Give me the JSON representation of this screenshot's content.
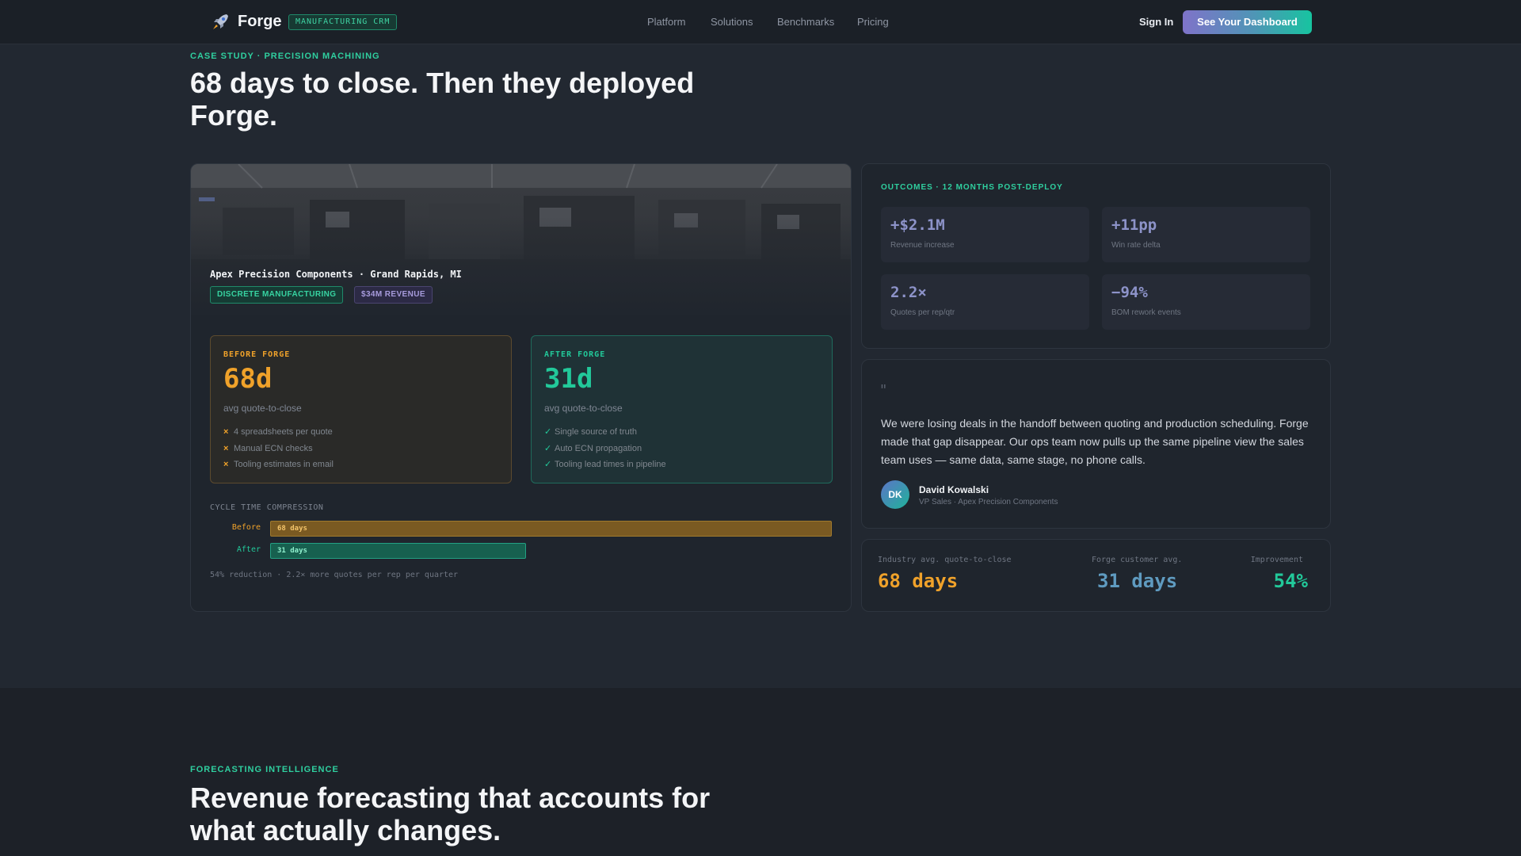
{
  "nav": {
    "brand": "Forge",
    "brand_badge": "MANUFACTURING CRM",
    "links": [
      "Platform",
      "Solutions",
      "Benchmarks",
      "Pricing"
    ],
    "sign_in": "Sign In",
    "cta": "See Your Dashboard"
  },
  "hero": {
    "eyebrow": "CASE STUDY · PRECISION MACHINING",
    "title": "68 days to close. Then they deployed Forge."
  },
  "case": {
    "company": "Apex Precision Components · Grand Rapids, MI",
    "tags": [
      "DISCRETE MANUFACTURING",
      "$34M REVENUE"
    ],
    "before": {
      "label": "BEFORE FORGE",
      "value": "68d",
      "sub": "avg quote-to-close",
      "items": [
        "4 spreadsheets per quote",
        "Manual ECN checks",
        "Tooling estimates in email"
      ]
    },
    "after": {
      "label": "AFTER FORGE",
      "value": "31d",
      "sub": "avg quote-to-close",
      "items": [
        "Single source of truth",
        "Auto ECN propagation",
        "Tooling lead times in pipeline"
      ]
    },
    "cycle": {
      "label": "CYCLE TIME COMPRESSION",
      "bars": [
        {
          "label": "Before",
          "text": "68 days",
          "days": 68,
          "color": "#f0a22a"
        },
        {
          "label": "After",
          "text": "31 days",
          "days": 31,
          "color": "#22c99a"
        }
      ],
      "note": "54% reduction · 2.2× more quotes per rep per quarter"
    }
  },
  "outcomes": {
    "title": "OUTCOMES · 12 MONTHS POST-DEPLOY",
    "stats": [
      {
        "value": "+$2.1M",
        "label": "Revenue increase"
      },
      {
        "value": "+11pp",
        "label": "Win rate delta"
      },
      {
        "value": "2.2×",
        "label": "Quotes per rep/qtr"
      },
      {
        "value": "−94%",
        "label": "BOM rework events"
      }
    ]
  },
  "testimonial": {
    "mark": "\"",
    "text": "We were losing deals in the handoff between quoting and production scheduling. Forge made that gap disappear. Our ops team now pulls up the same pipeline view the sales team uses — same data, same stage, no phone calls.",
    "initials": "DK",
    "name": "David Kowalski",
    "role": "VP Sales · Apex Precision Components"
  },
  "benchmark": {
    "industry_label": "Industry avg. quote-to-close",
    "industry_value": "68 days",
    "forge_label": "Forge customer avg.",
    "forge_value": "31 days",
    "improvement_label": "Improvement",
    "improvement_value": "54%"
  },
  "section2": {
    "eyebrow": "FORECASTING INTELLIGENCE",
    "title": "Revenue forecasting that accounts for what actually changes."
  },
  "colors": {
    "accent_green": "#22c99a",
    "accent_amber": "#f0a22a",
    "accent_purple": "#8d93c9",
    "background": "#222831"
  }
}
